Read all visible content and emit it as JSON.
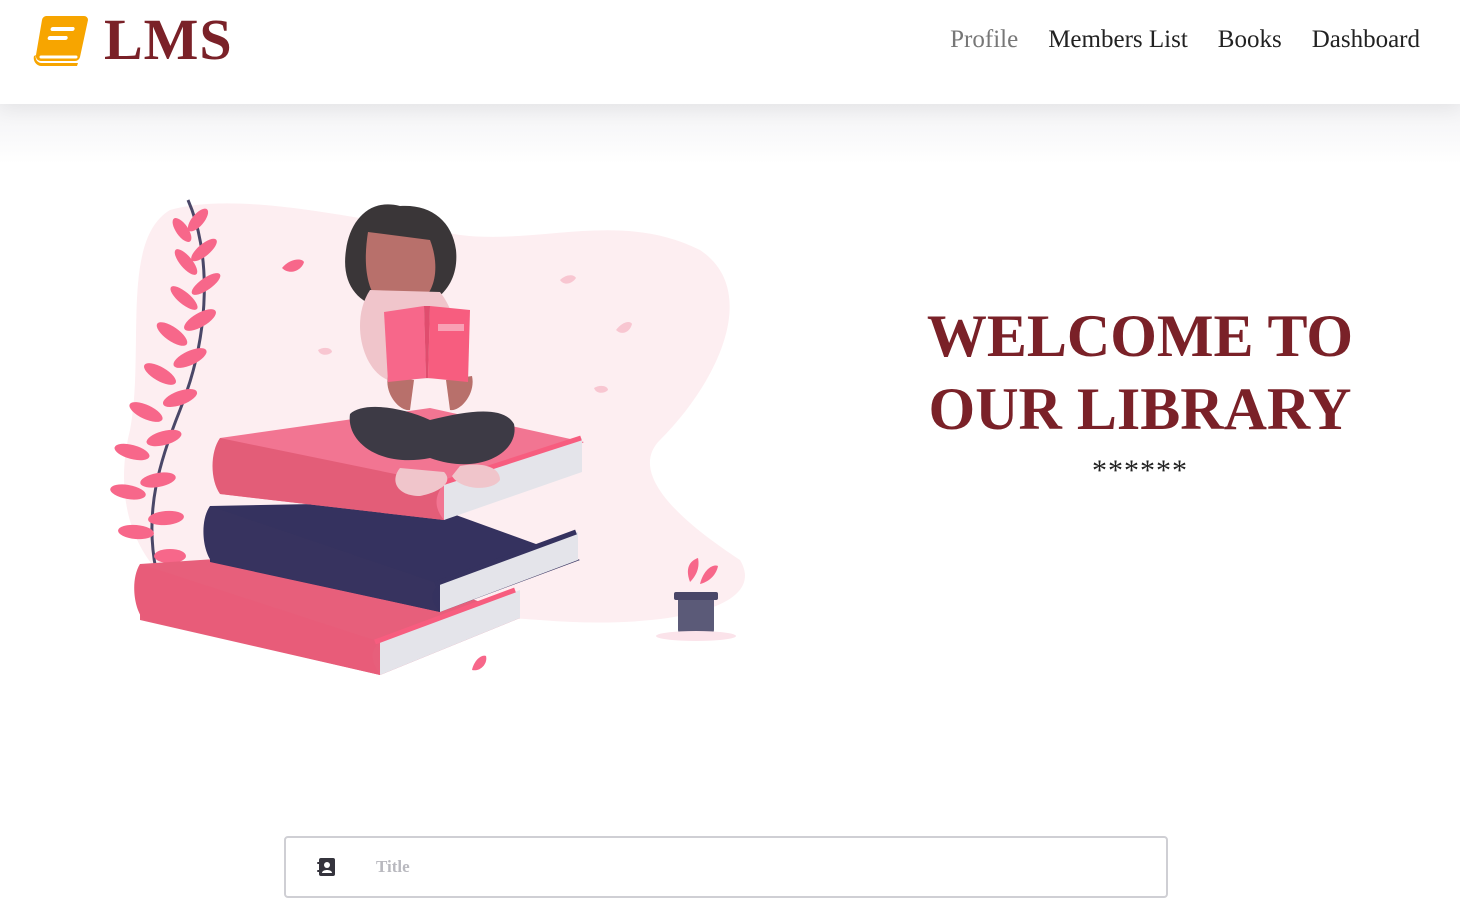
{
  "brand": {
    "name": "LMS",
    "icon": "book-icon",
    "icon_color": "#f7a500"
  },
  "nav": {
    "items": [
      {
        "label": "Profile",
        "muted": true
      },
      {
        "label": "Members List"
      },
      {
        "label": "Books"
      },
      {
        "label": "Dashboard"
      }
    ]
  },
  "hero": {
    "line1": "WELCOME TO",
    "line2": "OUR LIBRARY",
    "stars": "******",
    "illustration": "woman-reading-on-books-illustration"
  },
  "search": {
    "placeholder": "Title",
    "value": "",
    "icon": "contact-book-icon"
  },
  "colors": {
    "brand": "#7a2128",
    "accent_pink": "#f75d7f",
    "navy": "#35325f"
  }
}
